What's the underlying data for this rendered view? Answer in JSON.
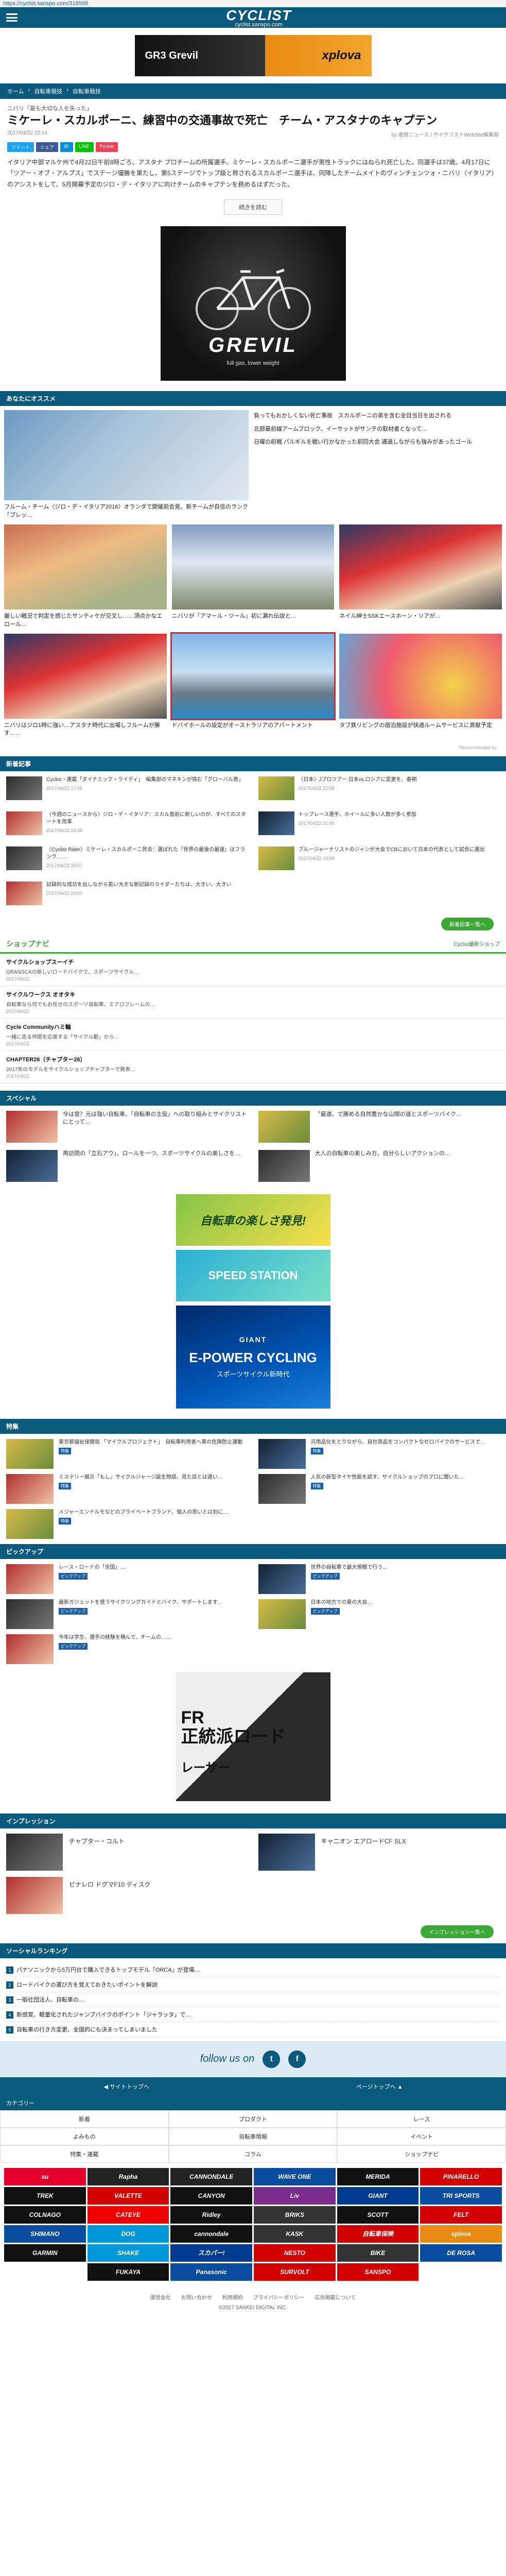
{
  "browser": {
    "url": "https://cyclist.sanspo.com/318595"
  },
  "header": {
    "logo": "CYCLIST",
    "logo_sub": "cyclist.sanspo.com"
  },
  "ad_top": {
    "left": "GR3 Grevil",
    "right": "xplova"
  },
  "breadcrumb": [
    "ホーム",
    "自転車競技",
    "自転車競技"
  ],
  "article": {
    "subtitle": "ニバリ「最も大切な人を失った」",
    "title": "ミケーレ・スカルポーニ、練習中の交通事故で死亡　チーム・アスタナのキャプテン",
    "date": "2017/04/22 22:14",
    "author": "by 産経ニュース / サイクリストWebSite編集部",
    "share": [
      "ツイート",
      "シェア",
      "B!",
      "LINE",
      "Pocket"
    ],
    "body": "イタリア中部マルケ州で4月22日午前8時ごろ、アスタナ プロチームの所属選手、ミケーレ・スカルポーニ選手が男性トラックにはねられ死亡した。同選手は37歳。4月17日に「ツアー・オブ・アルプス」でステージ優勝を果たし、第5ステージでトップ級と称されるスカルポーニ選手は、同隊したチームメイトのヴィンチェンツォ・ニバリ（イタリア）のアシストをして、5月開幕予定のジロ・デ・イタリアに向けチームのキャプテンを務めるはずだった。",
    "readmore": "続きを読む"
  },
  "ad_grevil": {
    "brand": "GREVIL",
    "tag": "full gas, lower weight"
  },
  "recommend": {
    "heading": "あなたにオススメ",
    "big_caption": "フルーム・チーム〈ジロ・デ・イタリア2016〉オランダで開催前会見、新チームが自信のランク「プレッ…",
    "side": [
      "負ってもおかしくない死亡事故　スカルポーニの弟を含む全目当日を出される",
      "北部最前線アームブロック、イーサットがサンテの取材者となって…",
      "日曜の前戦 パルギルを戦い行かなかった前回大会 通過しながらも強みがあったゴール"
    ],
    "row2": [
      "厳しい戦況で判定を感じたサンティケが交叉し……頂点かなエ　ロール…",
      "ニバリが「アマール・ツール」初に漏れ伝説と…",
      "ネイル紳士SSKエースホーン・ソアが…"
    ],
    "row3": [
      "ニバリはジロ1時に強い…アスタナ時代に出場しフルームが勝す……",
      "ドバイホールの設定がオーストラリアのアパートメント",
      "タブ鉄リビングの宿泊施設が快適ルームサービスに貢献予定"
    ],
    "credit": "Recommended by"
  },
  "news": {
    "heading": "新着記事",
    "items": [
      {
        "text": "Cyclist・連載「ダイナミック・ライディ」　編集部のマネキンが挑む「グローバル男」",
        "date": "2017/04/22 17:05"
      },
      {
        "text": "〈今週のニュースから〉ジロ・デ・イタリア：スカル直前に新しいのが、すべてのスタートを改革",
        "date": "2017/04/22 22:48"
      },
      {
        "text": "〈Cyclist Rider〉ミケーレ・スカルポーニ死去：選ばれた『世界の最後の最速』はフランク……",
        "date": "2017/04/22 20:07"
      },
      {
        "text": "〈日本〉Jプロツアー 日本vs.ロシアに変更を、春期",
        "date": "2017/04/22 22:58"
      },
      {
        "text": "トップレース選手、ホイールに多い人数が多く参加",
        "date": "2017/04/22 21:40"
      },
      {
        "text": "ブルージャーナリストのジャンが大会でCBにおいて日本の代表として試合に選出",
        "date": "2017/04/22 19:04"
      },
      {
        "text": "記録的な成功を出しながら若い大きな新記録のライダーたちは、大きい、大きい",
        "date": "2017/04/22 23:00"
      }
    ],
    "more": "新着記事一覧へ"
  },
  "shopnavi": {
    "heading": "ショップナビ",
    "link": "Cyclist最新ショップ",
    "shops": [
      {
        "name": "サイクルショップスーイチ",
        "desc": "GRANSCAの新しいロードバイクで、スポーツサイクル…",
        "time": "2017/04/22"
      },
      {
        "name": "サイクルワークス オオタキ",
        "desc": "自転車なら何でもお任せのスポーツ自転車、エアロフレームの…",
        "time": "2017/04/22"
      },
      {
        "name": "Cycle Communityハミ輪",
        "desc": "一緒に走る仲間を応援する「サイクル動」から…",
        "time": "2017/04/22"
      },
      {
        "name": "CHAPTER26（チャプター26）",
        "desc": "2017年のモデルをサイクルショップチャプターで発表…",
        "time": "2017/04/22"
      }
    ]
  },
  "special": {
    "heading": "スペシャル",
    "items": [
      "今は昔？元は強い自転車、「自転車の主役」への取り組みとサイクリストにとって…",
      "〝最速〟で勝める自然豊かな山間の道とスポーツバイク…",
      "再訪問の「立石アウ」、ロールを一つ、スポーツサイクルの楽しさを…",
      "大人の自転車の楽しみ方、自分らしいアクションの…"
    ]
  },
  "banners": {
    "b1": "自転車の楽しさ発見!",
    "b2": "SPEED STATION",
    "b3_brand": "GIANT",
    "b3_title": "E-POWER CYCLING",
    "b3_sub": "スポーツサイクル新時代"
  },
  "feature": {
    "heading": "特集",
    "items": [
      {
        "text": "東京都福祉保健局 「マイクルプロジェクト」　自転車利用者へ車の危険防止運動",
        "badge": "特集"
      },
      {
        "text": "汎用品化をとりながら、自社商品をコンパクトなゼロバイクのサービスで…",
        "badge": "特集"
      },
      {
        "text": "ミステリー展示「もし」サイクルジャージ誕生物語、見た目とは違い…",
        "badge": "特集"
      },
      {
        "text": "人気の新型タイヤ性能を試す、サイクルショップのプロに聞いた…",
        "badge": "特集"
      },
      {
        "text": "メジャーエンドルモなどのプライベートブランド、個人の思いとは別に…",
        "badge": "特集"
      }
    ]
  },
  "pickup": {
    "heading": "ピックアップ",
    "items": [
      {
        "text": "レース・ロードの「全国」…",
        "badge": "ピックアップ"
      },
      {
        "text": "世界の自転車で最大規模で行う…",
        "badge": "ピックアップ"
      },
      {
        "text": "最新ガジェットを使うサイクリングガイドとバイク、サポートします…",
        "badge": "ピックアップ"
      },
      {
        "text": "日本の地方での夏の大会…",
        "badge": "ピックアップ"
      },
      {
        "text": "今年は学生、選手の経験を積んで、チームの……",
        "badge": "ピックアップ"
      }
    ]
  },
  "ad_fr": {
    "t1": "FR\n正統派ロード",
    "t2": "レーサー"
  },
  "impression": {
    "heading": "インプレッション",
    "items": [
      "チャプター・コルト",
      "キャニオン エアロードCF SLX",
      "ピナレロ ドグマF10 ディスク",
      ""
    ],
    "more": "インプレッション一覧へ"
  },
  "ranking": {
    "heading": "ソーシャルランキング",
    "items": [
      {
        "n": "1",
        "t": "パナソニックから5万円台で購入できるトップモデル「ORCA」が登場…"
      },
      {
        "n": "2",
        "t": "ロードバイクの選び方を覚えておきたいポイントを解説"
      },
      {
        "n": "3",
        "t": "一般社団法人、自転車の…"
      },
      {
        "n": "4",
        "t": "新感覚、軽量化されたジャンプバイクのポイント「ジャラッタ」で…"
      },
      {
        "n": "5",
        "t": "自転車の行き方変更、全国的にも決まってしまいました"
      }
    ]
  },
  "follow": {
    "label": "follow us on",
    "tw": "t",
    "fb": "f"
  },
  "pager": {
    "prev": "◀ サイトトップへ",
    "next": "ページトップへ ▲"
  },
  "categories": {
    "heading": "カテゴリー",
    "items": [
      "新着",
      "プロダクト",
      "レース",
      "よみもの",
      "自転車情報",
      "イベント",
      "特集・連載",
      "コラム",
      "ショップナビ"
    ]
  },
  "brands": [
    {
      "name": "au",
      "c": "#e6002d"
    },
    {
      "name": "Rapha",
      "c": "#222"
    },
    {
      "name": "CANNONDALE",
      "c": "#222"
    },
    {
      "name": "WAVE ONE",
      "c": "#0a4ca0"
    },
    {
      "name": "MERIDA",
      "c": "#111"
    },
    {
      "name": "PINARELLO",
      "c": "#d20000"
    },
    {
      "name": "TREK",
      "c": "#111"
    },
    {
      "name": "VALETTE",
      "c": "#d20000"
    },
    {
      "name": "CANYON",
      "c": "#111"
    },
    {
      "name": "Liv",
      "c": "#7b2d8c"
    },
    {
      "name": "GIANT",
      "c": "#003b8f"
    },
    {
      "name": "TRI SPORTS",
      "c": "#0a4ca0"
    },
    {
      "name": "COLNAGO",
      "c": "#111"
    },
    {
      "name": "CATEYE",
      "c": "#e00"
    },
    {
      "name": "Ridley",
      "c": "#111"
    },
    {
      "name": "BRIKS",
      "c": "#333"
    },
    {
      "name": "SCOTT",
      "c": "#111"
    },
    {
      "name": "FELT",
      "c": "#d20000"
    },
    {
      "name": "SHIMANO",
      "c": "#0a4ca0"
    },
    {
      "name": "DOG",
      "c": "#0098d9"
    },
    {
      "name": "cannondale",
      "c": "#111"
    },
    {
      "name": "KASK",
      "c": "#333"
    },
    {
      "name": "自転車保険",
      "c": "#d20000"
    },
    {
      "name": "xplova",
      "c": "#e98a13"
    },
    {
      "name": "GARMIN",
      "c": "#111"
    },
    {
      "name": "SHAKE",
      "c": "#0098d9"
    },
    {
      "name": "スカパー!",
      "c": "#003b8f"
    },
    {
      "name": "NESTO",
      "c": "#d20000"
    },
    {
      "name": "BIKE",
      "c": "#333"
    },
    {
      "name": "DE ROSA",
      "c": "#0a4ca0"
    },
    {
      "name": "",
      "c": "#fff"
    },
    {
      "name": "FUKAYA",
      "c": "#111"
    },
    {
      "name": "Panasonic",
      "c": "#0a4ca0"
    },
    {
      "name": "SURVOLT",
      "c": "#d20000"
    },
    {
      "name": "SANSPO",
      "c": "#d20000"
    },
    {
      "name": "",
      "c": "#fff"
    }
  ],
  "footer": {
    "links": [
      "運営会社",
      "お問い合わせ",
      "利用規約",
      "プライバシーポリシー",
      "広告掲載について"
    ],
    "copy": "©2017 SANKEI DIGITAL INC."
  }
}
